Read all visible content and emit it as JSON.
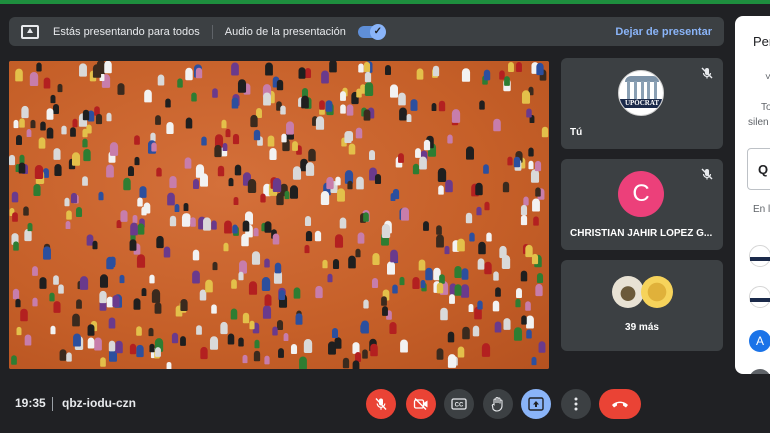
{
  "banner": {
    "presenting_text": "Estás presentando para todos",
    "audio_label": "Audio de la presentación",
    "audio_enabled": true,
    "stop_label": "Dejar de presentar"
  },
  "tiles": [
    {
      "name": "Tú",
      "avatar": "university-logo",
      "logo_text": "UPÓCRAT",
      "muted": true
    },
    {
      "name": "CHRISTIAN JAHIR LOPEZ G...",
      "avatar_letter": "C",
      "avatar_color": "#ec407a",
      "muted": true
    },
    {
      "name": "39 más"
    }
  ],
  "panel": {
    "title": "Per",
    "chevron": "˅",
    "line1": "To",
    "line2": "silen",
    "search_glyph": "Q",
    "section_label": "En l",
    "avatar_letter": "A"
  },
  "meeting": {
    "time": "19:35",
    "code": "qbz-iodu-czn"
  },
  "controls": {
    "mic": "muted",
    "camera": "off",
    "captions": "cc",
    "raise_hand": "hand",
    "present": "active",
    "more": "more",
    "leave": "end-call"
  },
  "colors": {
    "accent": "#8ab4f8",
    "danger": "#ea4335",
    "background": "#202124",
    "tile": "#3c4043"
  }
}
